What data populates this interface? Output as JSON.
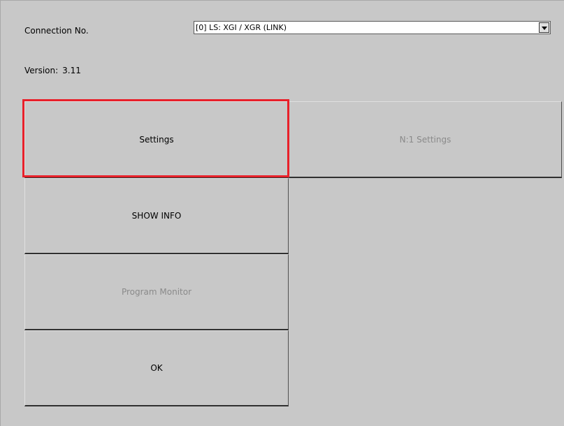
{
  "connection": {
    "label": "Connection No.",
    "selected": "[0] LS: XGI / XGR (LINK)"
  },
  "version": {
    "label": "Version:",
    "value": "3.11"
  },
  "buttons": {
    "settings": "Settings",
    "n1_settings": "N:1 Settings",
    "show_info": "SHOW INFO",
    "program_monitor": "Program Monitor",
    "ok": "OK"
  },
  "colors": {
    "background": "#c8c8c8",
    "highlight": "#e8202a",
    "disabled_text": "#8a8a8a"
  }
}
